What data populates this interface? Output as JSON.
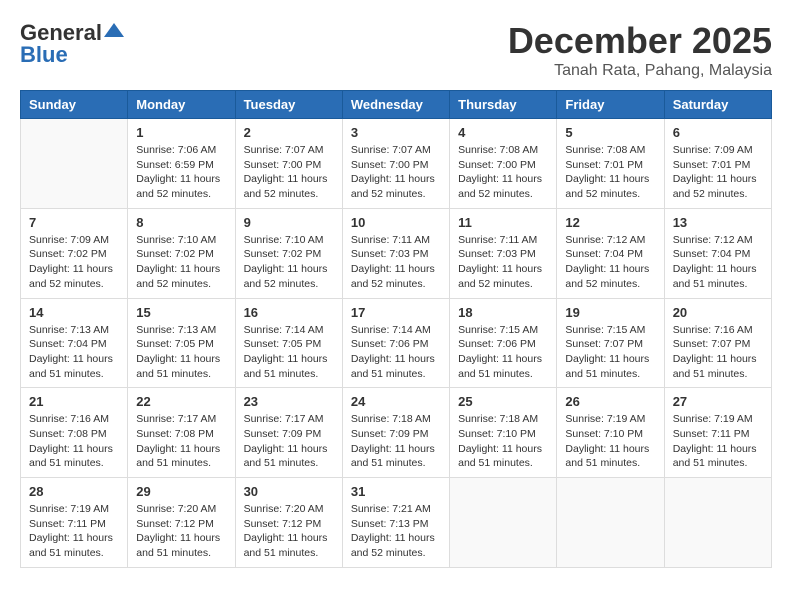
{
  "logo": {
    "general": "General",
    "blue": "Blue"
  },
  "title": {
    "month": "December 2025",
    "location": "Tanah Rata, Pahang, Malaysia"
  },
  "days_of_week": [
    "Sunday",
    "Monday",
    "Tuesday",
    "Wednesday",
    "Thursday",
    "Friday",
    "Saturday"
  ],
  "weeks": [
    [
      {
        "day": "",
        "empty": true
      },
      {
        "day": "1",
        "sunrise": "7:06 AM",
        "sunset": "6:59 PM",
        "daylight": "11 hours and 52 minutes."
      },
      {
        "day": "2",
        "sunrise": "7:07 AM",
        "sunset": "7:00 PM",
        "daylight": "11 hours and 52 minutes."
      },
      {
        "day": "3",
        "sunrise": "7:07 AM",
        "sunset": "7:00 PM",
        "daylight": "11 hours and 52 minutes."
      },
      {
        "day": "4",
        "sunrise": "7:08 AM",
        "sunset": "7:00 PM",
        "daylight": "11 hours and 52 minutes."
      },
      {
        "day": "5",
        "sunrise": "7:08 AM",
        "sunset": "7:01 PM",
        "daylight": "11 hours and 52 minutes."
      },
      {
        "day": "6",
        "sunrise": "7:09 AM",
        "sunset": "7:01 PM",
        "daylight": "11 hours and 52 minutes."
      }
    ],
    [
      {
        "day": "7",
        "sunrise": "7:09 AM",
        "sunset": "7:02 PM",
        "daylight": "11 hours and 52 minutes."
      },
      {
        "day": "8",
        "sunrise": "7:10 AM",
        "sunset": "7:02 PM",
        "daylight": "11 hours and 52 minutes."
      },
      {
        "day": "9",
        "sunrise": "7:10 AM",
        "sunset": "7:02 PM",
        "daylight": "11 hours and 52 minutes."
      },
      {
        "day": "10",
        "sunrise": "7:11 AM",
        "sunset": "7:03 PM",
        "daylight": "11 hours and 52 minutes."
      },
      {
        "day": "11",
        "sunrise": "7:11 AM",
        "sunset": "7:03 PM",
        "daylight": "11 hours and 52 minutes."
      },
      {
        "day": "12",
        "sunrise": "7:12 AM",
        "sunset": "7:04 PM",
        "daylight": "11 hours and 52 minutes."
      },
      {
        "day": "13",
        "sunrise": "7:12 AM",
        "sunset": "7:04 PM",
        "daylight": "11 hours and 51 minutes."
      }
    ],
    [
      {
        "day": "14",
        "sunrise": "7:13 AM",
        "sunset": "7:04 PM",
        "daylight": "11 hours and 51 minutes."
      },
      {
        "day": "15",
        "sunrise": "7:13 AM",
        "sunset": "7:05 PM",
        "daylight": "11 hours and 51 minutes."
      },
      {
        "day": "16",
        "sunrise": "7:14 AM",
        "sunset": "7:05 PM",
        "daylight": "11 hours and 51 minutes."
      },
      {
        "day": "17",
        "sunrise": "7:14 AM",
        "sunset": "7:06 PM",
        "daylight": "11 hours and 51 minutes."
      },
      {
        "day": "18",
        "sunrise": "7:15 AM",
        "sunset": "7:06 PM",
        "daylight": "11 hours and 51 minutes."
      },
      {
        "day": "19",
        "sunrise": "7:15 AM",
        "sunset": "7:07 PM",
        "daylight": "11 hours and 51 minutes."
      },
      {
        "day": "20",
        "sunrise": "7:16 AM",
        "sunset": "7:07 PM",
        "daylight": "11 hours and 51 minutes."
      }
    ],
    [
      {
        "day": "21",
        "sunrise": "7:16 AM",
        "sunset": "7:08 PM",
        "daylight": "11 hours and 51 minutes."
      },
      {
        "day": "22",
        "sunrise": "7:17 AM",
        "sunset": "7:08 PM",
        "daylight": "11 hours and 51 minutes."
      },
      {
        "day": "23",
        "sunrise": "7:17 AM",
        "sunset": "7:09 PM",
        "daylight": "11 hours and 51 minutes."
      },
      {
        "day": "24",
        "sunrise": "7:18 AM",
        "sunset": "7:09 PM",
        "daylight": "11 hours and 51 minutes."
      },
      {
        "day": "25",
        "sunrise": "7:18 AM",
        "sunset": "7:10 PM",
        "daylight": "11 hours and 51 minutes."
      },
      {
        "day": "26",
        "sunrise": "7:19 AM",
        "sunset": "7:10 PM",
        "daylight": "11 hours and 51 minutes."
      },
      {
        "day": "27",
        "sunrise": "7:19 AM",
        "sunset": "7:11 PM",
        "daylight": "11 hours and 51 minutes."
      }
    ],
    [
      {
        "day": "28",
        "sunrise": "7:19 AM",
        "sunset": "7:11 PM",
        "daylight": "11 hours and 51 minutes."
      },
      {
        "day": "29",
        "sunrise": "7:20 AM",
        "sunset": "7:12 PM",
        "daylight": "11 hours and 51 minutes."
      },
      {
        "day": "30",
        "sunrise": "7:20 AM",
        "sunset": "7:12 PM",
        "daylight": "11 hours and 51 minutes."
      },
      {
        "day": "31",
        "sunrise": "7:21 AM",
        "sunset": "7:13 PM",
        "daylight": "11 hours and 52 minutes."
      },
      {
        "day": "",
        "empty": true
      },
      {
        "day": "",
        "empty": true
      },
      {
        "day": "",
        "empty": true
      }
    ]
  ]
}
